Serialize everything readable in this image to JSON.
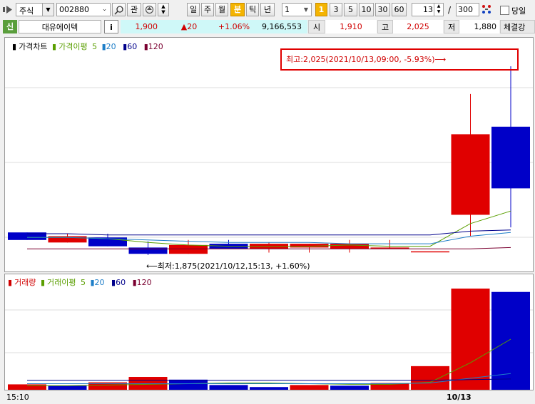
{
  "toolbar": {
    "market": "주식",
    "code": "002880",
    "btn_gwan": "관",
    "period_buttons": [
      "일",
      "주",
      "월",
      "분",
      "틱",
      "년"
    ],
    "active_period": "분",
    "interval_value": "1",
    "interval_buttons": [
      "1",
      "3",
      "5",
      "10",
      "30",
      "60"
    ],
    "active_interval": "1",
    "count_value": "13",
    "separator": "/",
    "total_value": "300",
    "today_label": "당일"
  },
  "quote": {
    "badge": "신",
    "name": "대유에이텍",
    "info_btn": "i",
    "price": "1,900",
    "change": "▲20",
    "change_rate": "+1.06%",
    "volume": "9,166,553",
    "open_label": "시",
    "open": "1,910",
    "high_label": "고",
    "high": "2,025",
    "low_label": "저",
    "low": "1,880",
    "extra_label": "체결강"
  },
  "price_panel": {
    "title": "가격차트",
    "ma_label": "가격이평",
    "ma_periods": [
      "5",
      "20",
      "60",
      "120"
    ],
    "high_annot": "최고:2,025(2021/10/13,09:00, -5.93%)⟶",
    "low_annot": "⟵최저:1,875(2021/10/12,15:13, +1.60%)"
  },
  "volume_panel": {
    "title": "거래량",
    "ma_label": "거래이평",
    "ma_periods": [
      "5",
      "20",
      "60",
      "120"
    ]
  },
  "axis": {
    "left_time": "15:10",
    "right_date": "10/13"
  },
  "colors": {
    "up": "#e00000",
    "down": "#0000c8",
    "ma5": "#5a9e00",
    "ma20": "#1e7ec8",
    "ma60": "#00008b",
    "ma120": "#7a0030"
  },
  "chart_data": {
    "type": "candlestick",
    "price_range": [
      1875,
      2025
    ],
    "candles": [
      {
        "o": 1893,
        "h": 1893,
        "l": 1887,
        "c": 1887
      },
      {
        "o": 1885,
        "h": 1892,
        "l": 1885,
        "c": 1890
      },
      {
        "o": 1889,
        "h": 1892,
        "l": 1882,
        "c": 1882
      },
      {
        "o": 1881,
        "h": 1886,
        "l": 1875,
        "c": 1876
      },
      {
        "o": 1876,
        "h": 1887,
        "l": 1876,
        "c": 1883
      },
      {
        "o": 1884,
        "h": 1887,
        "l": 1880,
        "c": 1880
      },
      {
        "o": 1880,
        "h": 1885,
        "l": 1877,
        "c": 1884
      },
      {
        "o": 1881,
        "h": 1884,
        "l": 1877,
        "c": 1884
      },
      {
        "o": 1880,
        "h": 1887,
        "l": 1877,
        "c": 1884
      },
      {
        "o": 1881,
        "h": 1887,
        "l": 1880,
        "c": 1881
      },
      {
        "o": 1878,
        "h": 1878,
        "l": 1878,
        "c": 1878
      },
      {
        "o": 1907,
        "h": 2003,
        "l": 1890,
        "c": 1971
      },
      {
        "o": 1977,
        "h": 2025,
        "l": 1897,
        "c": 1928
      }
    ],
    "ma5": [
      1889,
      1889,
      1888,
      1885,
      1883,
      1882,
      1882,
      1882,
      1883,
      1882,
      1882,
      1900,
      1910
    ],
    "ma20": [
      1889,
      1889,
      1888,
      1887,
      1886,
      1885,
      1885,
      1885,
      1884,
      1884,
      1884,
      1890,
      1893
    ],
    "ma60": [
      1892,
      1892,
      1891,
      1891,
      1891,
      1891,
      1891,
      1891,
      1891,
      1891,
      1891,
      1894,
      1895
    ],
    "ma120": [
      1880,
      1880,
      1880,
      1880,
      1880,
      1880,
      1880,
      1880,
      1880,
      1880,
      1880,
      1880,
      1881
    ],
    "volume": [
      {
        "v": 8,
        "up": true
      },
      {
        "v": 6,
        "up": false
      },
      {
        "v": 11,
        "up": true
      },
      {
        "v": 19,
        "up": true
      },
      {
        "v": 15,
        "up": false
      },
      {
        "v": 7,
        "up": false
      },
      {
        "v": 4,
        "up": false
      },
      {
        "v": 7,
        "up": true
      },
      {
        "v": 6,
        "up": false
      },
      {
        "v": 10,
        "up": true
      },
      {
        "v": 35,
        "up": true
      },
      {
        "v": 150,
        "up": true
      },
      {
        "v": 145,
        "up": false
      }
    ],
    "volume_max": 150,
    "vol_ma5": [
      6,
      6,
      7,
      8,
      9,
      10,
      10,
      9,
      8,
      8,
      11,
      40,
      75
    ],
    "vol_ma20": [
      9,
      9,
      9,
      9,
      9,
      9,
      9,
      9,
      9,
      9,
      10,
      17,
      24
    ],
    "vol_ma60": [
      14,
      14,
      14,
      14,
      14,
      14,
      14,
      14,
      14,
      14,
      14,
      15,
      16
    ]
  }
}
